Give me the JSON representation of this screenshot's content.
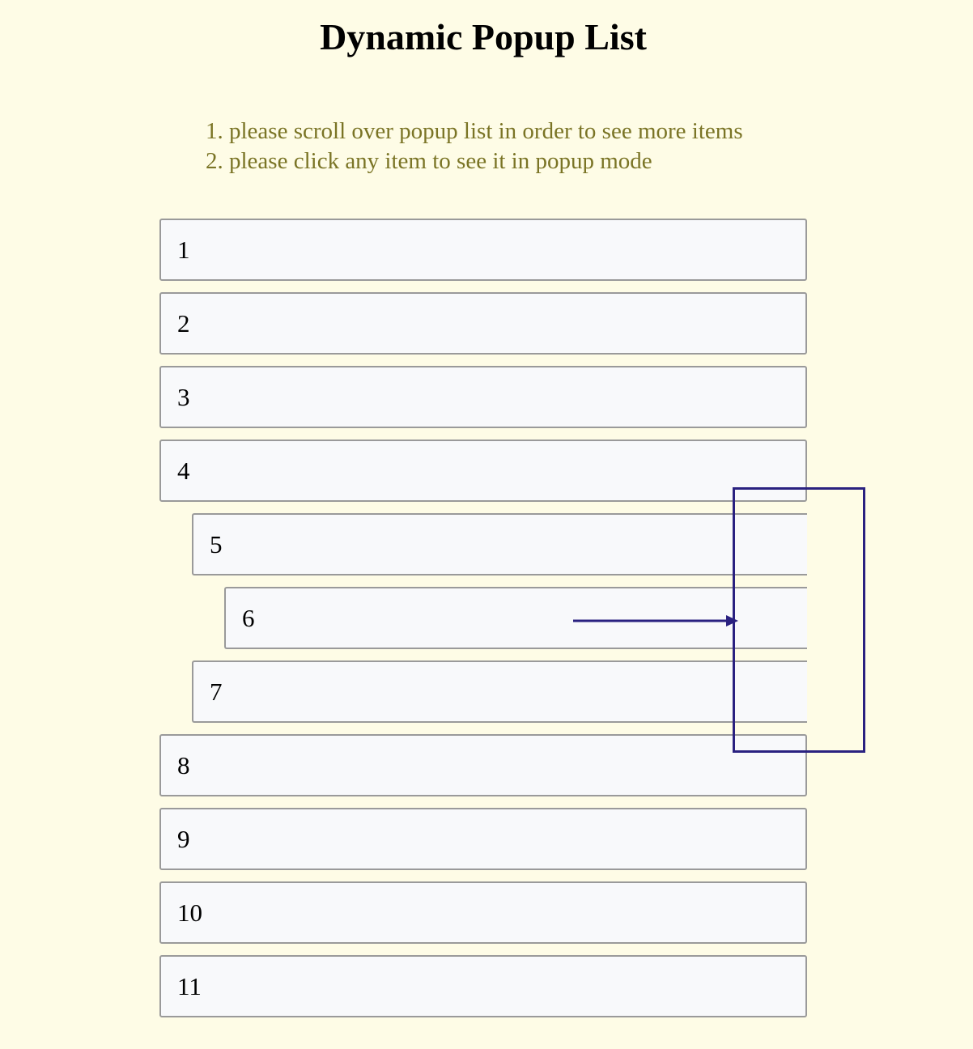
{
  "page": {
    "title": "Dynamic Popup List"
  },
  "instructions": [
    "please scroll over popup list in order to see more items",
    "please click any item to see it in popup mode"
  ],
  "items": [
    "1",
    "2",
    "3",
    "4",
    "5",
    "6",
    "7",
    "8",
    "9",
    "10",
    "11"
  ],
  "colors": {
    "background": "#fefce6",
    "instruction_text": "#7a7425",
    "item_background": "#f8f9fb",
    "item_border": "#9a9a9a",
    "annotation": "#2a2180"
  }
}
